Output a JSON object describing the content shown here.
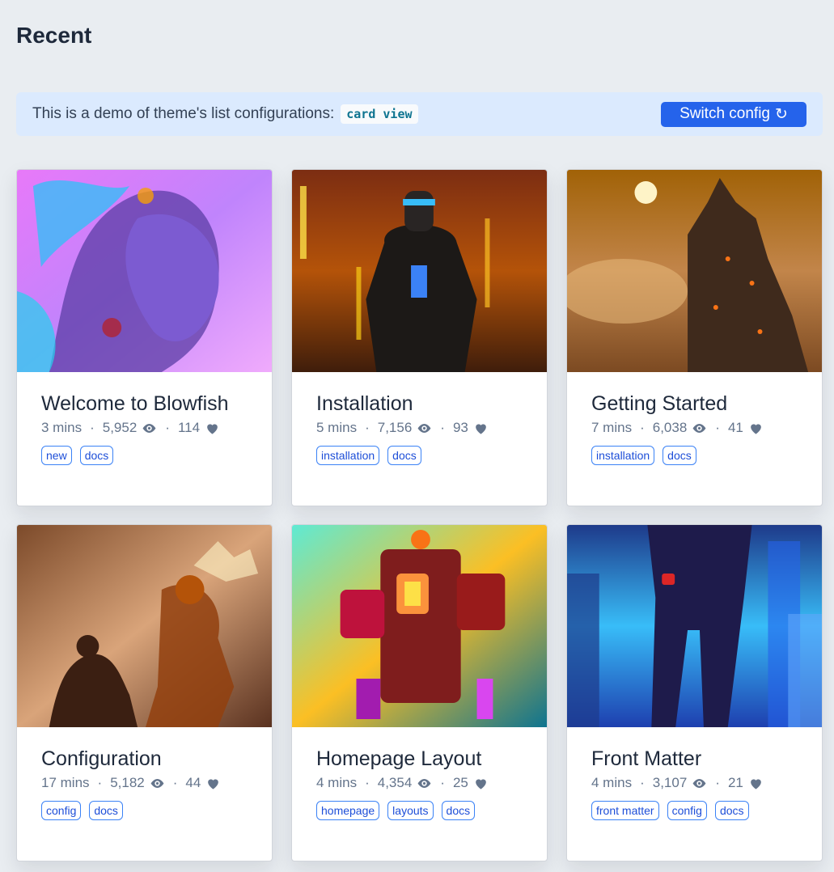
{
  "page": {
    "title": "Recent"
  },
  "banner": {
    "text": "This is a demo of theme's list configurations:",
    "code": "card view",
    "button_label": "Switch config",
    "button_icon": "refresh-icon"
  },
  "icons": {
    "views": "eye-icon",
    "likes": "heart-icon"
  },
  "cards": [
    {
      "title": "Welcome to Blowfish",
      "read_time": "3 mins",
      "views": "5,952",
      "likes": "114",
      "tags": [
        "new",
        "docs"
      ]
    },
    {
      "title": "Installation",
      "read_time": "5 mins",
      "views": "7,156",
      "likes": "93",
      "tags": [
        "installation",
        "docs"
      ]
    },
    {
      "title": "Getting Started",
      "read_time": "7 mins",
      "views": "6,038",
      "likes": "41",
      "tags": [
        "installation",
        "docs"
      ]
    },
    {
      "title": "Configuration",
      "read_time": "17 mins",
      "views": "5,182",
      "likes": "44",
      "tags": [
        "config",
        "docs"
      ]
    },
    {
      "title": "Homepage Layout",
      "read_time": "4 mins",
      "views": "4,354",
      "likes": "25",
      "tags": [
        "homepage",
        "layouts",
        "docs"
      ]
    },
    {
      "title": "Front Matter",
      "read_time": "4 mins",
      "views": "3,107",
      "likes": "21",
      "tags": [
        "front matter",
        "config",
        "docs"
      ]
    }
  ],
  "colors": {
    "accent": "#2563eb",
    "banner_bg": "#dbeafe",
    "tag_border": "#3b82f6",
    "tag_text": "#1d4ed8"
  }
}
